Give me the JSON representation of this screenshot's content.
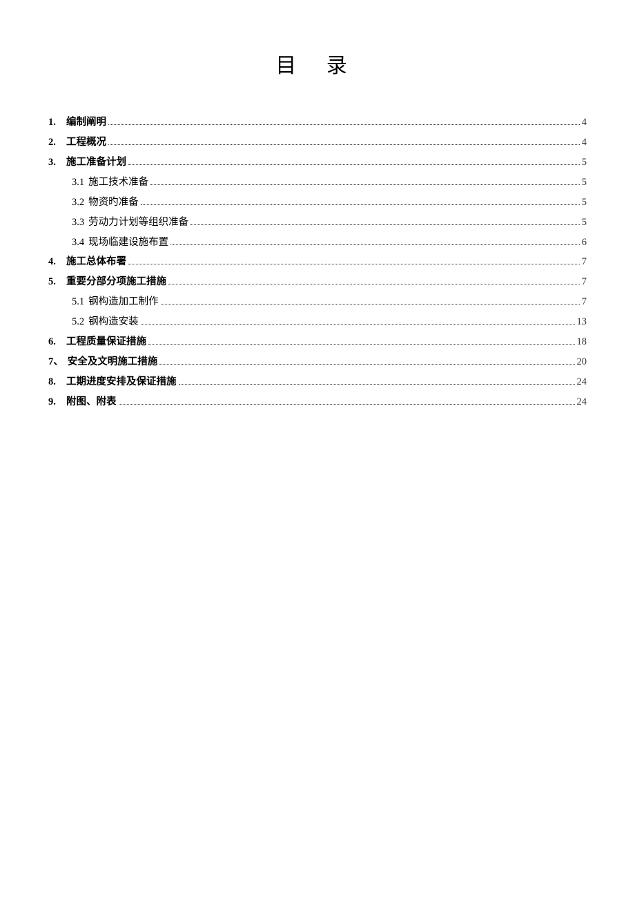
{
  "title": "目 录",
  "toc": [
    {
      "level": 1,
      "num": "1.",
      "label": "编制阐明",
      "page": "4"
    },
    {
      "level": 1,
      "num": "2.",
      "label": "工程概况",
      "page": "4"
    },
    {
      "level": 1,
      "num": "3.",
      "label": "施工准备计划",
      "page": "5"
    },
    {
      "level": 2,
      "num": "3.1",
      "label": "施工技术准备",
      "page": "5"
    },
    {
      "level": 2,
      "num": "3.2",
      "label": "物资旳准备",
      "page": "5"
    },
    {
      "level": 2,
      "num": "3.3",
      "label": "劳动力计划等组织准备",
      "page": "5"
    },
    {
      "level": 2,
      "num": "3.4",
      "label": "现场临建设施布置",
      "page": "6"
    },
    {
      "level": 1,
      "num": "4.",
      "label": "施工总体布署",
      "page": "7"
    },
    {
      "level": 1,
      "num": "5.",
      "label": "重要分部分项施工措施",
      "page": "7"
    },
    {
      "level": 2,
      "num": "5.1",
      "label": "钢构造加工制作",
      "page": "7"
    },
    {
      "level": 2,
      "num": "5.2",
      "label": "钢构造安装",
      "page": "13"
    },
    {
      "level": 1,
      "num": "6.",
      "label": "工程质量保证措施",
      "page": "18"
    },
    {
      "level": 1,
      "num": "7、",
      "label": "安全及文明施工措施",
      "page": "20"
    },
    {
      "level": 1,
      "num": "8.",
      "label": "工期进度安排及保证措施",
      "page": "24"
    },
    {
      "level": 1,
      "num": "9.",
      "label": "附图、附表",
      "page": "24"
    }
  ]
}
